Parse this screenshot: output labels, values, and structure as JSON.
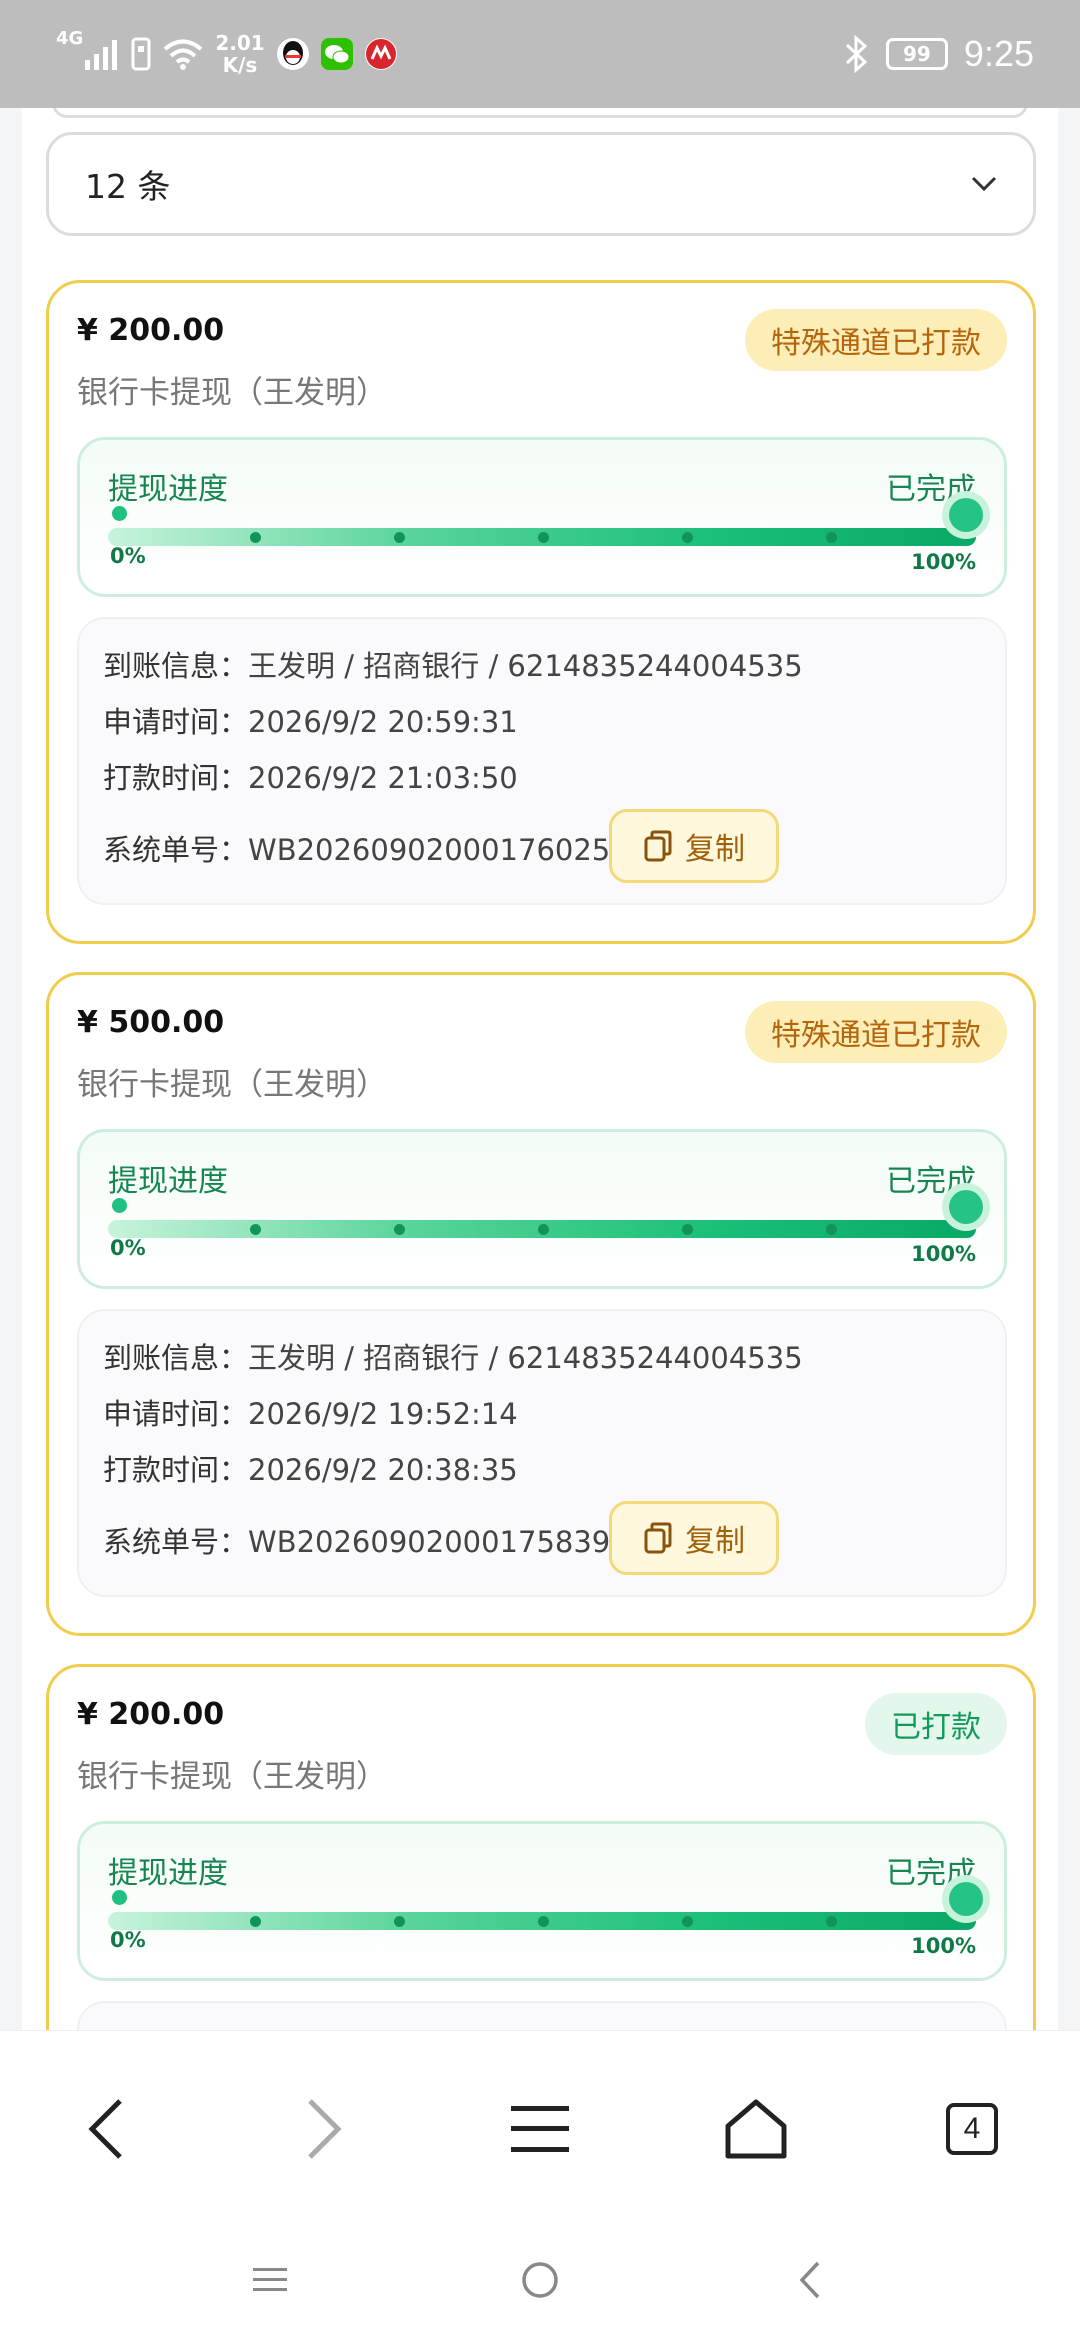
{
  "status_bar": {
    "network_type": "4G",
    "speed_value": "2.01",
    "speed_unit": "K/s",
    "battery": "99",
    "time": "9:25",
    "icons": [
      "signal-icon",
      "sim-icon",
      "wifi-icon",
      "qq-icon",
      "wechat-icon",
      "bank-app-icon",
      "bluetooth-icon"
    ]
  },
  "filter": {
    "selected": "12 条"
  },
  "records": [
    {
      "amount": "¥ 200.00",
      "title": "银行卡提现（王发明）",
      "badge": "特殊通道已打款",
      "badge_type": "special",
      "progress_label": "提现进度",
      "progress_status": "已完成",
      "progress_start": "0%",
      "progress_end": "100%",
      "progress_value": 1.0,
      "account_label": "到账信息：",
      "account_value": "王发明 / 招商银行 / 6214835244004535",
      "apply_label": "申请时间：",
      "apply_time": "2026/9/2 20:59:31",
      "pay_label": "打款时间：",
      "pay_time": "2026/9/2 21:03:50",
      "order_label": "系统单号：",
      "order_no": "WB20260902000176025",
      "copy_label": "复制"
    },
    {
      "amount": "¥ 500.00",
      "title": "银行卡提现（王发明）",
      "badge": "特殊通道已打款",
      "badge_type": "special",
      "progress_label": "提现进度",
      "progress_status": "已完成",
      "progress_start": "0%",
      "progress_end": "100%",
      "progress_value": 1.0,
      "account_label": "到账信息：",
      "account_value": "王发明 / 招商银行 / 6214835244004535",
      "apply_label": "申请时间：",
      "apply_time": "2026/9/2 19:52:14",
      "pay_label": "打款时间：",
      "pay_time": "2026/9/2 20:38:35",
      "order_label": "系统单号：",
      "order_no": "WB20260902000175839",
      "copy_label": "复制"
    },
    {
      "amount": "¥ 200.00",
      "title": "银行卡提现（王发明）",
      "badge": "已打款",
      "badge_type": "paid",
      "progress_label": "提现进度",
      "progress_status": "已完成",
      "progress_start": "0%",
      "progress_end": "100%",
      "progress_value": 1.0
    }
  ],
  "browser_nav": {
    "tab_count": "4"
  },
  "colors": {
    "card_border": "#f1cd4d",
    "progress_green": "#12b26f",
    "badge_special_bg": "#fdeeb8",
    "badge_paid_bg": "#e4f7ec"
  }
}
